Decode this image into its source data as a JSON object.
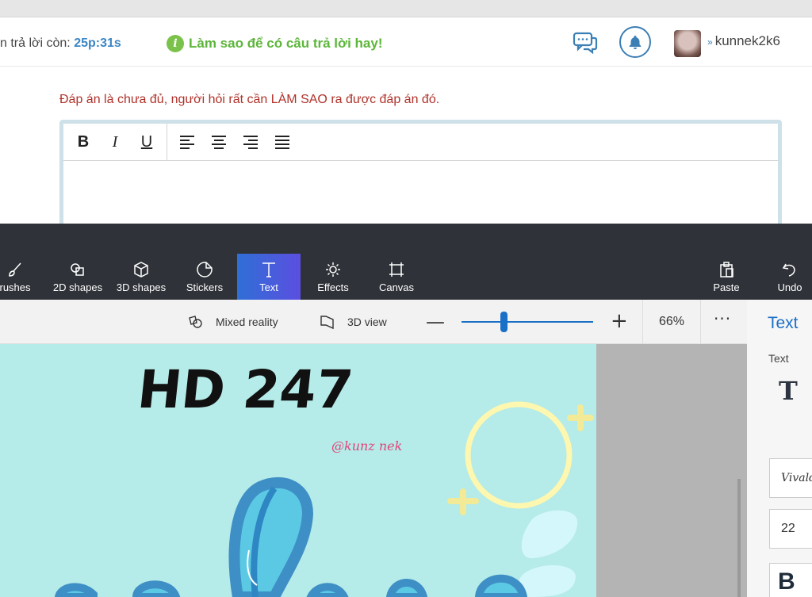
{
  "page": {
    "countdown_prefix": "n trả lời còn: ",
    "countdown_value": "25p:31s",
    "tip_icon": "i",
    "tip_text": "Làm sao để có câu trả lời hay!",
    "username": "kunnek2k6",
    "user_chevron": "»",
    "note": "Đáp án là chưa đủ, người hỏi rất cần LÀM SAO ra được đáp án đó.",
    "editor_buttons": [
      "B",
      "I",
      "U"
    ]
  },
  "paint": {
    "tools": [
      {
        "id": "brushes",
        "label": "rushes"
      },
      {
        "id": "2d-shapes",
        "label": "2D shapes"
      },
      {
        "id": "3d-shapes",
        "label": "3D shapes"
      },
      {
        "id": "stickers",
        "label": "Stickers"
      },
      {
        "id": "text",
        "label": "Text"
      },
      {
        "id": "effects",
        "label": "Effects"
      },
      {
        "id": "canvas",
        "label": "Canvas"
      }
    ],
    "paste_label": "Paste",
    "undo_label": "Undo",
    "mixed_reality": "Mixed reality",
    "view_3d": "3D view",
    "zoom_minus": "—",
    "zoom_plus": "+",
    "zoom": "66%",
    "zoom_fraction": 0.32,
    "more": "···",
    "canvas_title": "HD 247",
    "canvas_signature": "@kunz nek",
    "side_title": "Text",
    "side_label": "Text",
    "side_text_icon": "T",
    "font_name": "Vivaldi",
    "font_size": "22",
    "bold_label": "B"
  }
}
